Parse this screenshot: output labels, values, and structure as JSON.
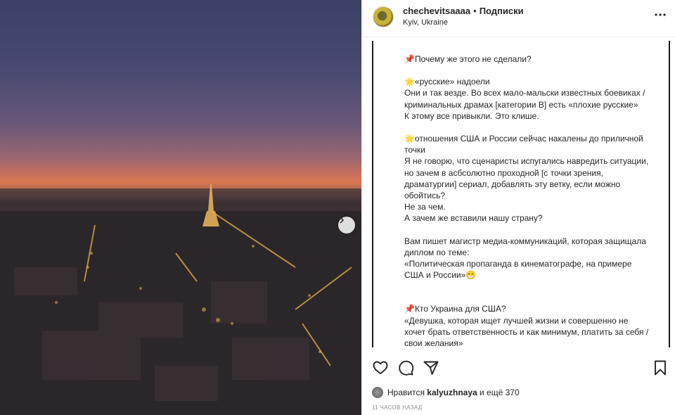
{
  "post": {
    "username": "chechevitsaaaa",
    "separator": "•",
    "follow_label": "Подписки",
    "location": "Kyiv, Ukraine"
  },
  "caption": {
    "l1": "📌Почему же этого не сделали?",
    "l2": "🌟«русские» надоели",
    "l3": "Они и так везде. Во всех мало-мальски известных боевиках / криминальных драмах [категории B] есть «плохие русские»",
    "l4": "К этому все привыкли. Это клише.",
    "l5": "🌟отношения США и России сейчас накалены до приличной точки",
    "l6": "Я не говорю, что сценаристы испугались навредить ситуации, но зачем в асбсолютно проходной [с точки зрения, драматургии] сериал, добавлять эту ветку, если можно обойтись?",
    "l7": "Не за чем.",
    "l8": "А зачем же вставили нашу страну?",
    "l9": "Вам пишет магистр медиа-коммуникаций, которая защищала диплом по теме:",
    "l10": "«Политическая пропаганда в кинематографе, на примере США и России»😁",
    "l11": "📌Кто Украина для США?",
    "l12": "«Девушка, которая ищет лучшей жизни и совершенно не хочет брать ответственность и как минимум, платить за себя / свои желания»"
  },
  "likes": {
    "prefix": "Нравится",
    "user": "kalyuzhnaya",
    "suffix": "и ещё 370"
  },
  "time_ago": "11 часов назад",
  "icons": {
    "more": "more-horizontal-icon",
    "like": "heart-icon",
    "comment": "comment-icon",
    "share": "paper-plane-icon",
    "save": "bookmark-icon",
    "next": "chevron-right-icon"
  }
}
